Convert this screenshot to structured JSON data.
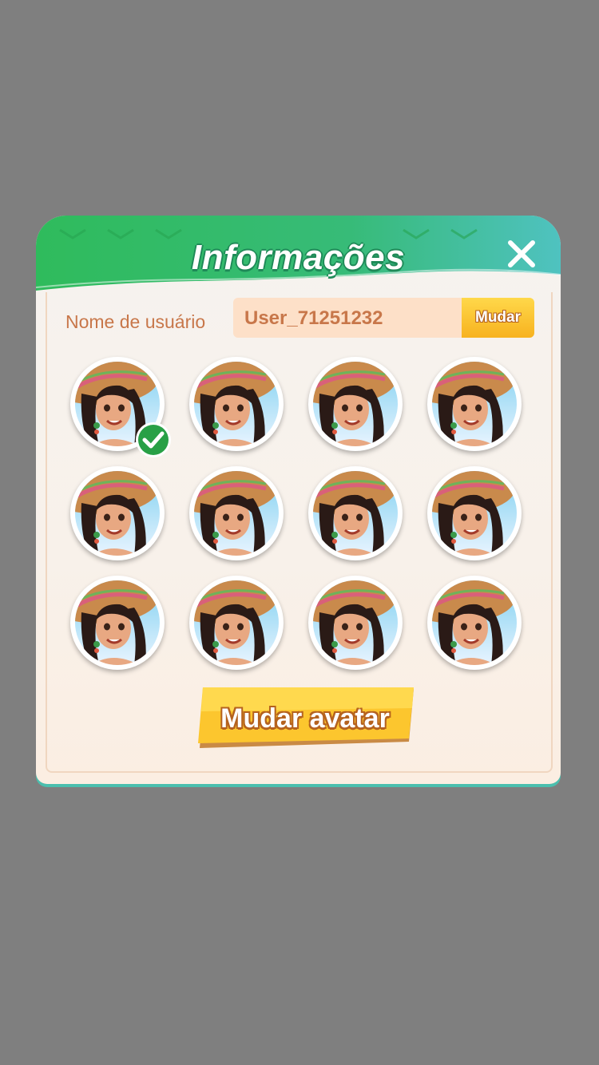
{
  "dialog": {
    "title": "Informações",
    "close_icon": "close-icon"
  },
  "username": {
    "label": "Nome de usuário",
    "value": "User_71251232",
    "change_label": "Mudar"
  },
  "avatars": {
    "count": 12,
    "selected_index": 0,
    "selected_icon": "check-icon"
  },
  "change_avatar_label": "Mudar avatar",
  "colors": {
    "header_green": "#2fbb62",
    "header_teal": "#4fc0b8",
    "accent_yellow": "#fcc62e",
    "label_brown": "#c8774a",
    "check_green": "#28a046"
  }
}
